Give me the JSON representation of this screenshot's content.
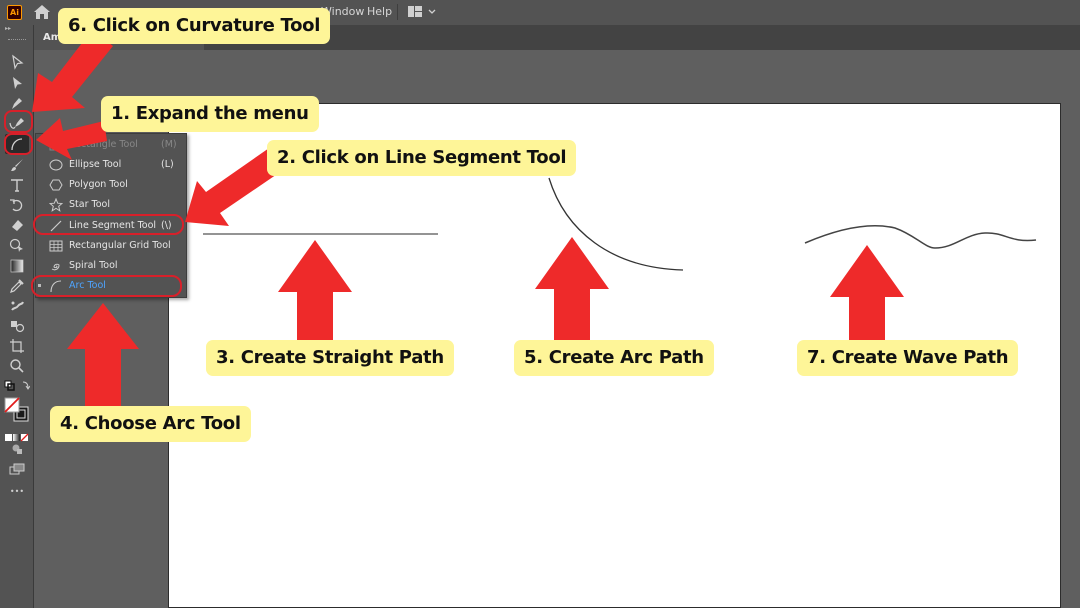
{
  "app": {
    "logo_text": "Ai",
    "menu": [
      {
        "label": "Window"
      },
      {
        "label": "Help"
      }
    ],
    "document_tab": "Am"
  },
  "toolbar": {
    "collapse_glyph": "▸▸",
    "tools": [
      {
        "name": "selection-tool"
      },
      {
        "name": "direct-selection-tool"
      },
      {
        "name": "pen-tool"
      },
      {
        "name": "curvature-tool"
      },
      {
        "name": "arc-tool",
        "active": true
      },
      {
        "name": "paintbrush-tool"
      },
      {
        "name": "type-tool"
      },
      {
        "name": "rotate-tool"
      },
      {
        "name": "eraser-tool"
      },
      {
        "name": "shape-builder-tool"
      },
      {
        "name": "gradient-tool"
      },
      {
        "name": "eyedropper-tool"
      },
      {
        "name": "puppet-warp-tool"
      },
      {
        "name": "blend-tool"
      },
      {
        "name": "artboard-tool"
      },
      {
        "name": "zoom-tool"
      }
    ],
    "more_label": "•••"
  },
  "flyout": {
    "items": [
      {
        "label": "Rectangle Tool",
        "shortcut": "(M)",
        "icon": "rectangle-icon"
      },
      {
        "label": "Ellipse Tool",
        "shortcut": "(L)",
        "icon": "ellipse-icon"
      },
      {
        "label": "Polygon Tool",
        "shortcut": "",
        "icon": "polygon-icon"
      },
      {
        "label": "Star Tool",
        "shortcut": "",
        "icon": "star-icon"
      },
      {
        "label": "Line Segment Tool",
        "shortcut": "(\\)",
        "icon": "line-icon"
      },
      {
        "label": "Rectangular Grid Tool",
        "shortcut": "",
        "icon": "grid-icon"
      },
      {
        "label": "Spiral Tool",
        "shortcut": "",
        "icon": "spiral-icon"
      },
      {
        "label": "Arc Tool",
        "shortcut": "",
        "icon": "arc-icon",
        "selected": true
      }
    ]
  },
  "annotations": {
    "step1": "1. Expand the menu",
    "step2": "2. Click on Line Segment Tool",
    "step3": "3. Create Straight Path",
    "step4": "4. Choose Arc Tool",
    "step5": "5. Create Arc Path",
    "step6": "6. Click on Curvature Tool",
    "step7": "7. Create Wave Path"
  },
  "colors": {
    "callout_bg": "#fef598",
    "arrow_red": "#ee2a2a",
    "ring_red": "#d8202a",
    "selected_blue": "#4ea4ff"
  }
}
